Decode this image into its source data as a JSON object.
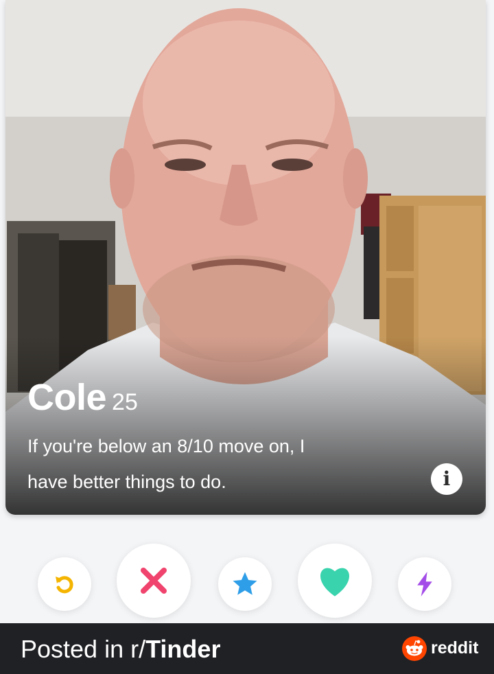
{
  "profile": {
    "name": "Cole",
    "age": "25",
    "bio_line1": "If you're below an 8/10 move on, I",
    "bio_line2": "have better things to do.",
    "info_label": "i",
    "photo_icon": "profile-photo"
  },
  "actions": [
    {
      "name": "rewind",
      "icon": "rewind-icon",
      "color": "#f4b400"
    },
    {
      "name": "nope",
      "icon": "x-icon",
      "color": "#f0436d"
    },
    {
      "name": "super-like",
      "icon": "star-icon",
      "color": "#2f9ee8"
    },
    {
      "name": "like",
      "icon": "heart-icon",
      "color": "#39d3ad"
    },
    {
      "name": "boost",
      "icon": "lightning-icon",
      "color": "#a34ce8"
    }
  ],
  "footer": {
    "posted_prefix": "Posted in r/",
    "subreddit": "Tinder",
    "brand": "reddit",
    "brand_color": "#ff4500"
  }
}
